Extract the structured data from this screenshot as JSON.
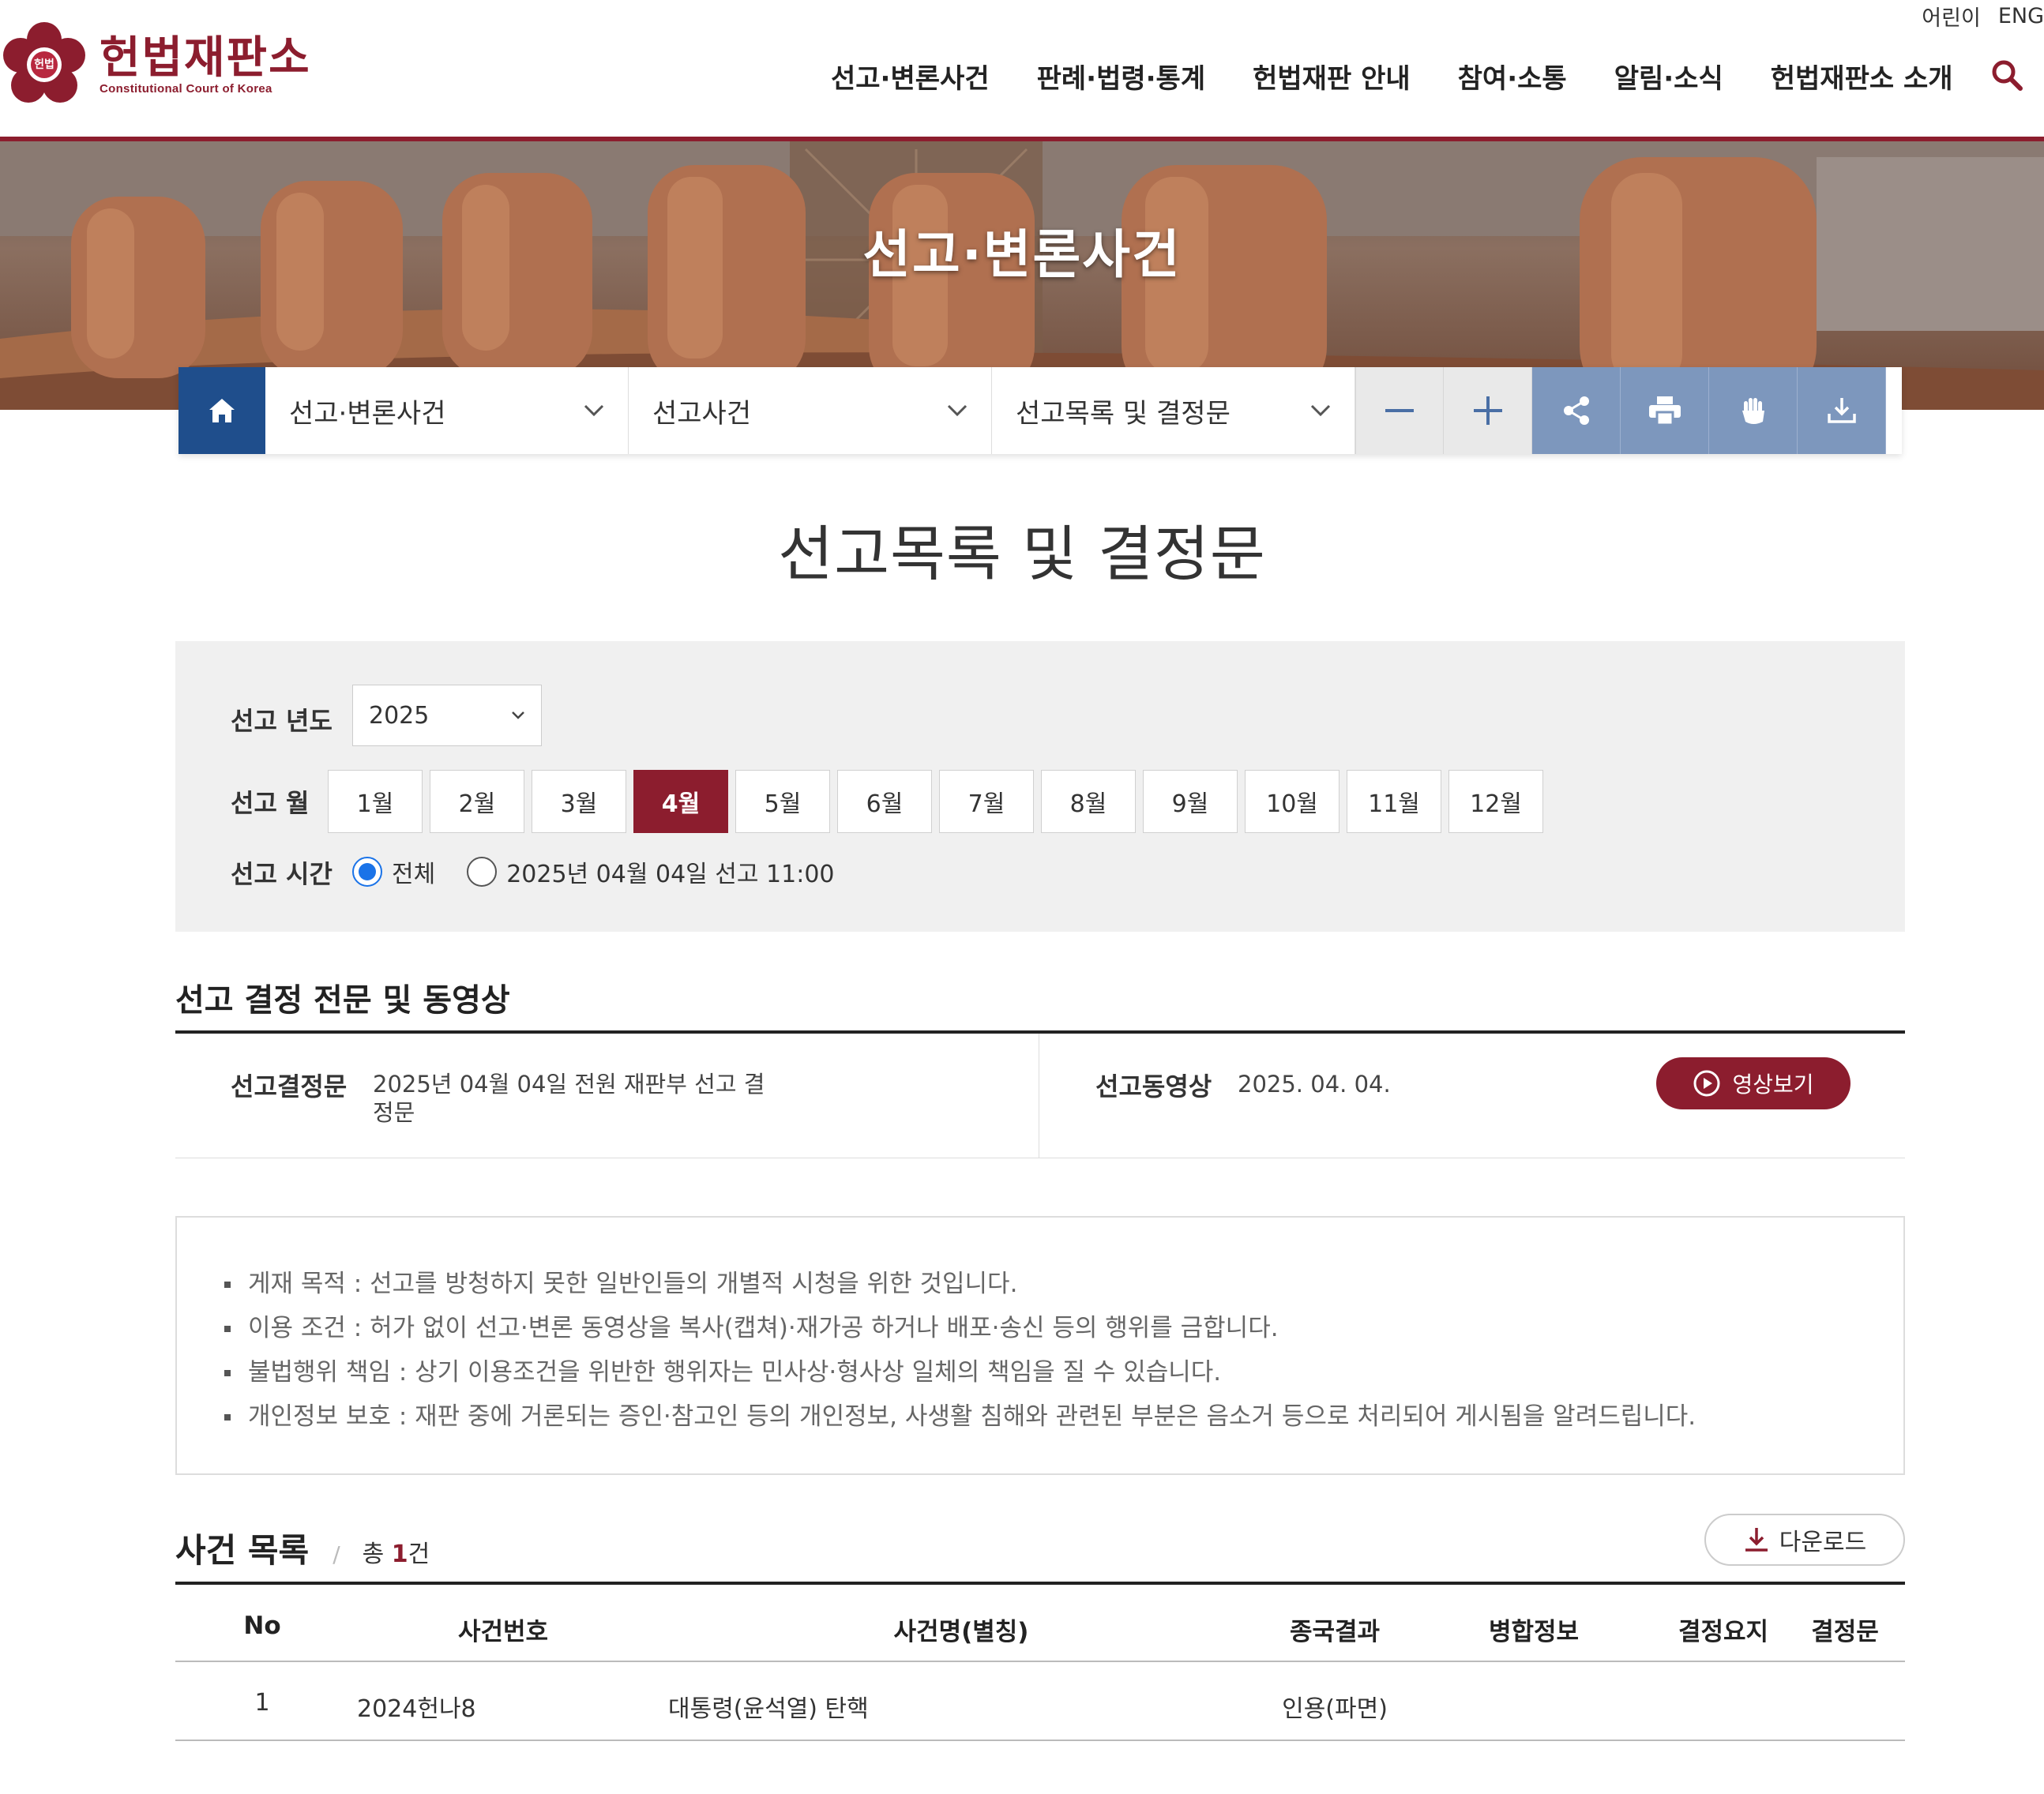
{
  "util_links": [
    "어린이",
    "ENG"
  ],
  "logo": {
    "title": "헌법재판소",
    "subtitle": "Constitutional Court of Korea",
    "seal_text": "헌법"
  },
  "gnb": [
    "선고·변론사건",
    "판례·법령·통계",
    "헌법재판 안내",
    "참여·소통",
    "알림·소식",
    "헌법재판소 소개"
  ],
  "hero_title": "선고·변론사건",
  "location": [
    "선고·변론사건",
    "선고사건",
    "선고목록 및 결정문"
  ],
  "tools": [
    "zoom-out",
    "zoom-in",
    "share",
    "print",
    "hand-gesture",
    "download-arrow"
  ],
  "page_title": "선고목록 및 결정문",
  "filter": {
    "year_label": "선고 년도",
    "year_value": "2025",
    "month_label": "선고 월",
    "months": [
      "1월",
      "2월",
      "3월",
      "4월",
      "5월",
      "6월",
      "7월",
      "8월",
      "9월",
      "10월",
      "11월",
      "12월"
    ],
    "active_month": "4월",
    "time_label": "선고 시간",
    "time_options": [
      "전체",
      "2025년 04월 04일 선고 11:00"
    ],
    "time_selected": "전체"
  },
  "decision_section": {
    "title": "선고 결정 전문 및 동영상",
    "decision_label": "선고결정문",
    "decision_text_line1": "2025년 04월 04일 전원 재판부 선고 결",
    "decision_text_line2": "정문",
    "video_label": "선고동영상",
    "video_date": "2025. 04. 04.",
    "video_button": "영상보기"
  },
  "notice": [
    "게재 목적 : 선고를 방청하지 못한 일반인들의 개별적 시청을 위한 것입니다.",
    "이용 조건 : 허가 없이 선고·변론 동영상을 복사(캡쳐)·재가공 하거나 배포·송신 등의 행위를 금합니다.",
    "불법행위 책임 : 상기 이용조건을 위반한 행위자는 민사상·형사상 일체의 책임을 질 수 있습니다.",
    "개인정보 보호 : 재판 중에 거론되는 증인·참고인 등의 개인정보, 사생활 침해와 관련된 부분은 음소거 등으로 처리되어 게시됨을 알려드립니다."
  ],
  "case_list": {
    "title": "사건 목록",
    "count_prefix": "총 ",
    "count": "1",
    "count_suffix": "건",
    "download": "다운로드",
    "columns": [
      "No",
      "사건번호",
      "사건명(별칭)",
      "종국결과",
      "병합정보",
      "결정요지",
      "결정문"
    ],
    "rows": [
      {
        "no": "1",
        "case_no": "2024헌나8",
        "name": "대통령(윤석열) 탄핵",
        "result": "인용(파면)",
        "merge": "",
        "summary": "",
        "decision": ""
      }
    ]
  },
  "colors": {
    "brand": "#8c1d2e",
    "home_blue": "#1f4e8c",
    "tool_blue": "#7d97bd",
    "radio_blue": "#1a73e8"
  }
}
